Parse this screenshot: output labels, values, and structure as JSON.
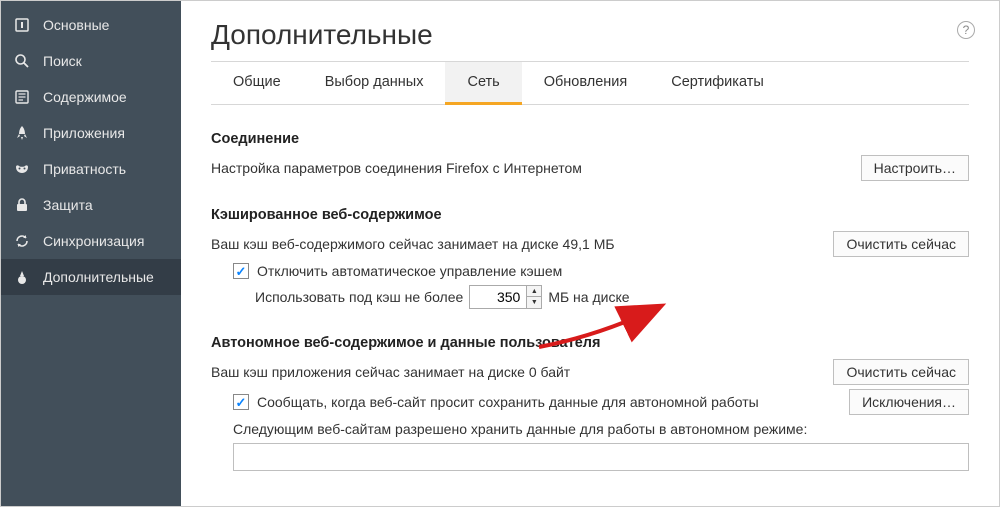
{
  "sidebar": {
    "items": [
      {
        "label": "Основные",
        "icon": "general"
      },
      {
        "label": "Поиск",
        "icon": "search"
      },
      {
        "label": "Содержимое",
        "icon": "content"
      },
      {
        "label": "Приложения",
        "icon": "apps"
      },
      {
        "label": "Приватность",
        "icon": "privacy"
      },
      {
        "label": "Защита",
        "icon": "security"
      },
      {
        "label": "Синхронизация",
        "icon": "sync"
      },
      {
        "label": "Дополнительные",
        "icon": "advanced"
      }
    ],
    "active_index": 7
  },
  "page": {
    "title": "Дополнительные"
  },
  "tabs": {
    "items": [
      "Общие",
      "Выбор данных",
      "Сеть",
      "Обновления",
      "Сертификаты"
    ],
    "active_index": 2
  },
  "connection": {
    "heading": "Соединение",
    "desc": "Настройка параметров соединения Firefox с Интернетом",
    "settings_btn": "Настроить…"
  },
  "cache": {
    "heading": "Кэшированное веб-содержимое",
    "usage_text": "Ваш кэш веб-содержимого сейчас занимает на диске 49,1 МБ",
    "clear_btn": "Очистить сейчас",
    "override_label": "Отключить автоматическое управление кэшем",
    "limit_prefix": "Использовать под кэш не более",
    "limit_value": "350",
    "limit_suffix": "МБ на диске",
    "override_checked": true
  },
  "offline": {
    "heading": "Автономное веб-содержимое и данные пользователя",
    "usage_text": "Ваш кэш приложения сейчас занимает на диске 0 байт",
    "clear_btn": "Очистить сейчас",
    "notify_label": "Сообщать, когда веб-сайт просит сохранить данные для автономной работы",
    "notify_checked": true,
    "exceptions_btn": "Исключения…",
    "list_label": "Следующим веб-сайтам разрешено хранить данные для работы в автономном режиме:"
  }
}
